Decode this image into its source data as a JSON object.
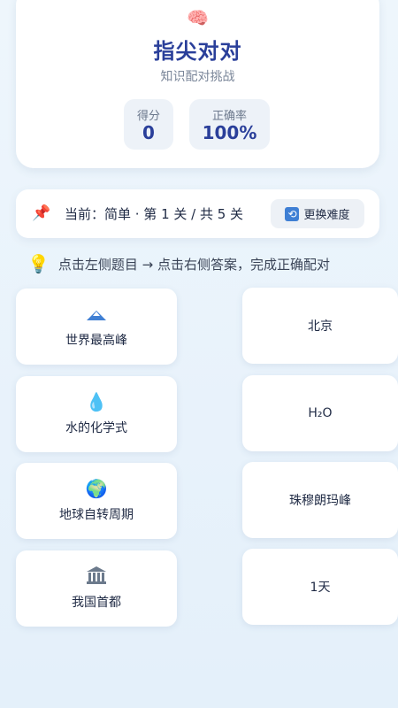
{
  "header": {
    "icon": "brain-icon",
    "title": "指尖对对",
    "subtitle": "知识配对挑战",
    "stats": {
      "score_label": "得分",
      "score_value": "0",
      "accuracy_label": "正确率",
      "accuracy_value": "100%"
    }
  },
  "level": {
    "icon": "pin-icon",
    "text": "当前：简单 · 第 1 关 / 共 5 关",
    "change_button_label": "更换难度",
    "change_button_icon": "refresh-icon"
  },
  "hint": {
    "icon": "lightbulb-icon",
    "text": "点击左侧题目 → 点击右侧答案，完成正确配对"
  },
  "questions": [
    {
      "icon": "mountain-icon",
      "label": "世界最高峰"
    },
    {
      "icon": "water-drop-icon",
      "label": "水的化学式"
    },
    {
      "icon": "globe-icon",
      "label": "地球自转周期"
    },
    {
      "icon": "government-building-icon",
      "label": "我国首都"
    }
  ],
  "answers": [
    {
      "label": "北京"
    },
    {
      "label": "H₂O"
    },
    {
      "label": "珠穆朗玛峰"
    },
    {
      "label": "1天"
    }
  ],
  "colors": {
    "accent": "#2a3f9a",
    "background": "#eef6fc",
    "card": "#ffffff",
    "stat_bg": "#edf2f8"
  }
}
